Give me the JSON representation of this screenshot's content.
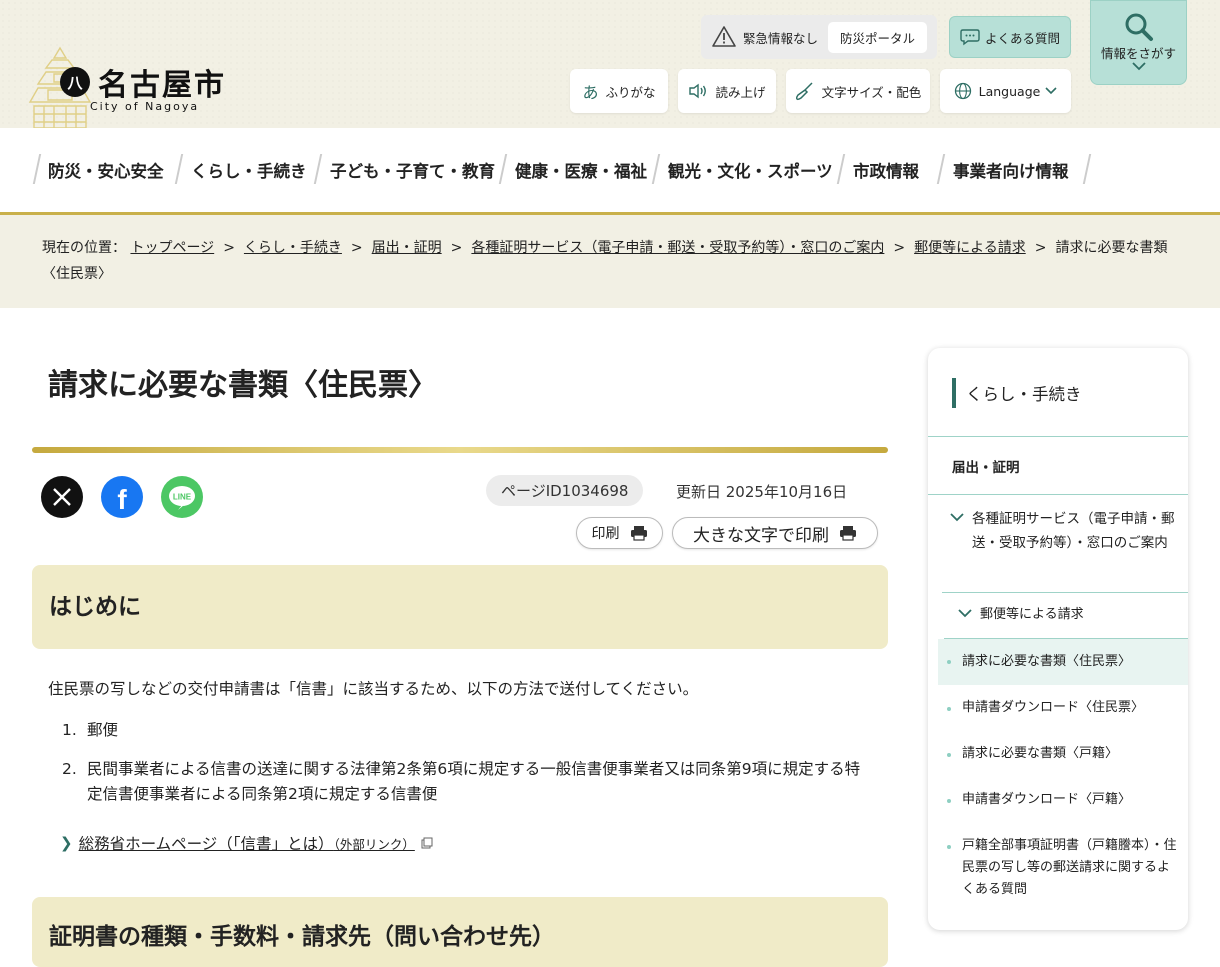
{
  "header": {
    "logo_mark": "八",
    "logo_text": "名古屋市",
    "logo_sub": "City of Nagoya",
    "emergency_text": "緊急情報なし",
    "portal_label": "防災ポータル",
    "faq_label": "よくある質問",
    "search_label": "情報をさがす",
    "tools": {
      "furigana": "ふりがな",
      "readout": "読み上げ",
      "fontsize": "文字サイズ・配色",
      "language": "Language"
    }
  },
  "nav": {
    "items": [
      "防災・安心安全",
      "くらし・手続き",
      "子ども・子育て・教育",
      "健康・医療・福祉",
      "観光・文化・スポーツ",
      "市政情報",
      "事業者向け情報"
    ]
  },
  "breadcrumb": {
    "prefix": "現在の位置：",
    "links": [
      "トップページ",
      "くらし・手続き",
      "届出・証明",
      "各種証明サービス（電子申請・郵送・受取予約等）・窓口のご案内",
      "郵便等による請求"
    ],
    "current": "請求に必要な書類〈住民票〉"
  },
  "page": {
    "title": "請求に必要な書類〈住民票〉",
    "page_id": "ページID1034698",
    "updated": "更新日 2025年10月16日",
    "print_label": "印刷",
    "print_large_label": "大きな文字で印刷"
  },
  "sns": {
    "x": "X",
    "facebook": "f",
    "line": "LINE"
  },
  "section1": {
    "heading": "はじめに",
    "intro": "住民票の写しなどの交付申請書は「信書」に該当するため、以下の方法で送付してください。",
    "list": [
      {
        "num": "1.",
        "text": "郵便"
      },
      {
        "num": "2.",
        "text": "民間事業者による信書の送達に関する法律第2条第6項に規定する一般信書便事業者又は同条第9項に規定する特定信書便事業者による同条第2項に規定する信書便"
      }
    ],
    "link_text": "総務省ホームページ（「信書」とは）",
    "link_suffix": "（外部リンク）"
  },
  "section2": {
    "heading": "証明書の種類・手数料・請求先（問い合わせ先）"
  },
  "sidebar": {
    "heading": "くらし・手続き",
    "sub": "届出・証明",
    "cat1": "各種証明サービス（電子申請・郵送・受取予約等）・窓口のご案内",
    "cat2": "郵便等による請求",
    "items": [
      "請求に必要な書類〈住民票〉",
      "申請書ダウンロード〈住民票〉",
      "請求に必要な書類〈戸籍〉",
      "申請書ダウンロード〈戸籍〉",
      "戸籍全部事項証明書（戸籍謄本）・住民票の写し等の郵送請求に関するよくある質問"
    ]
  },
  "colors": {
    "accent_green": "#2e6e64",
    "gold": "#c9b04a",
    "header_bg": "#f2f0e4",
    "section_bg": "#f0ebc8"
  }
}
